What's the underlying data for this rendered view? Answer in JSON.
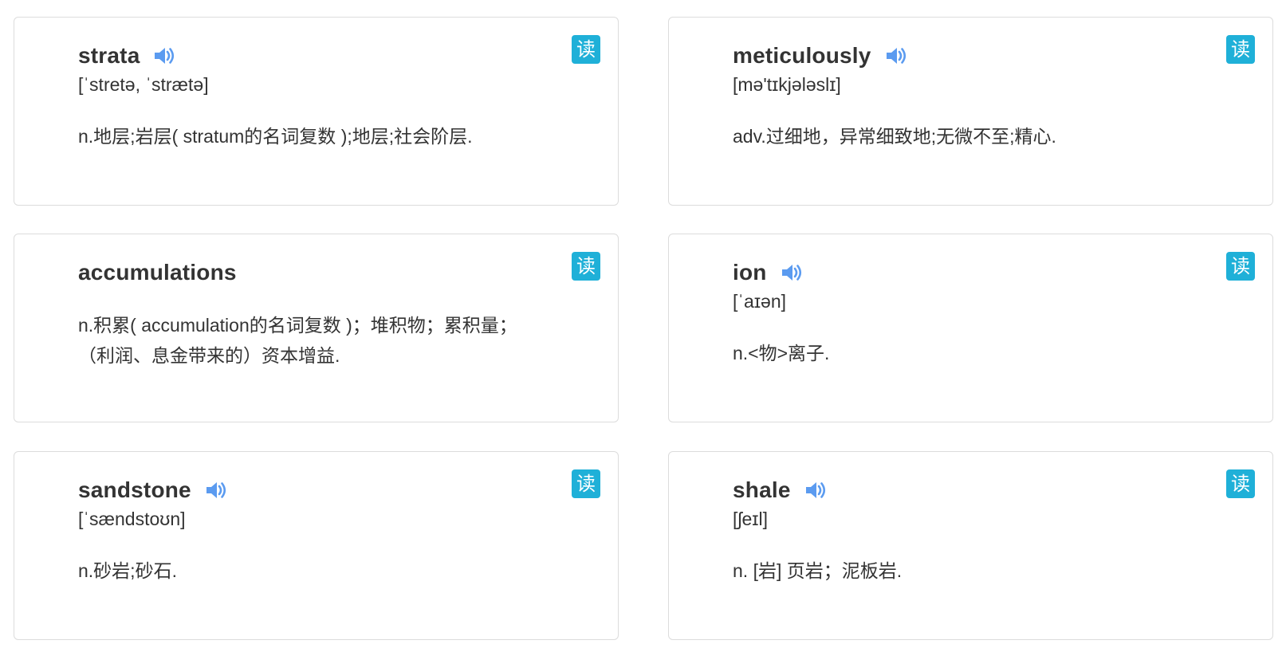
{
  "cards": [
    {
      "word": "strata",
      "phonetic": "[ˈstretə, ˈstrætə]",
      "definition": "n.地层;岩层( stratum的名词复数 );地层;社会阶层.",
      "read_label": "读"
    },
    {
      "word": "meticulously",
      "phonetic": "[mə'tɪkjələslɪ]",
      "definition": "adv.过细地，异常细致地;无微不至;精心.",
      "read_label": "读"
    },
    {
      "word": "accumulations",
      "phonetic": "",
      "definition": "n.积累( accumulation的名词复数 )；堆积物；累积量；（利润、息金带来的）资本增益.",
      "read_label": "读"
    },
    {
      "word": "ion",
      "phonetic": "[ˈaɪən]",
      "definition": "n.<物>离子.",
      "read_label": "读"
    },
    {
      "word": "sandstone",
      "phonetic": "[ˈsændstoʊn]",
      "definition": "n.砂岩;砂石.",
      "read_label": "读"
    },
    {
      "word": "shale",
      "phonetic": "[ʃeɪl]",
      "definition": "n. [岩] 页岩；泥板岩.",
      "read_label": "读"
    }
  ],
  "colors": {
    "speaker_icon": "#5b9bf0",
    "read_button_bg": "#1fb0d8",
    "card_border": "#dcdcdc",
    "text": "#333333"
  },
  "icons": {
    "speaker": "speaker-icon"
  }
}
